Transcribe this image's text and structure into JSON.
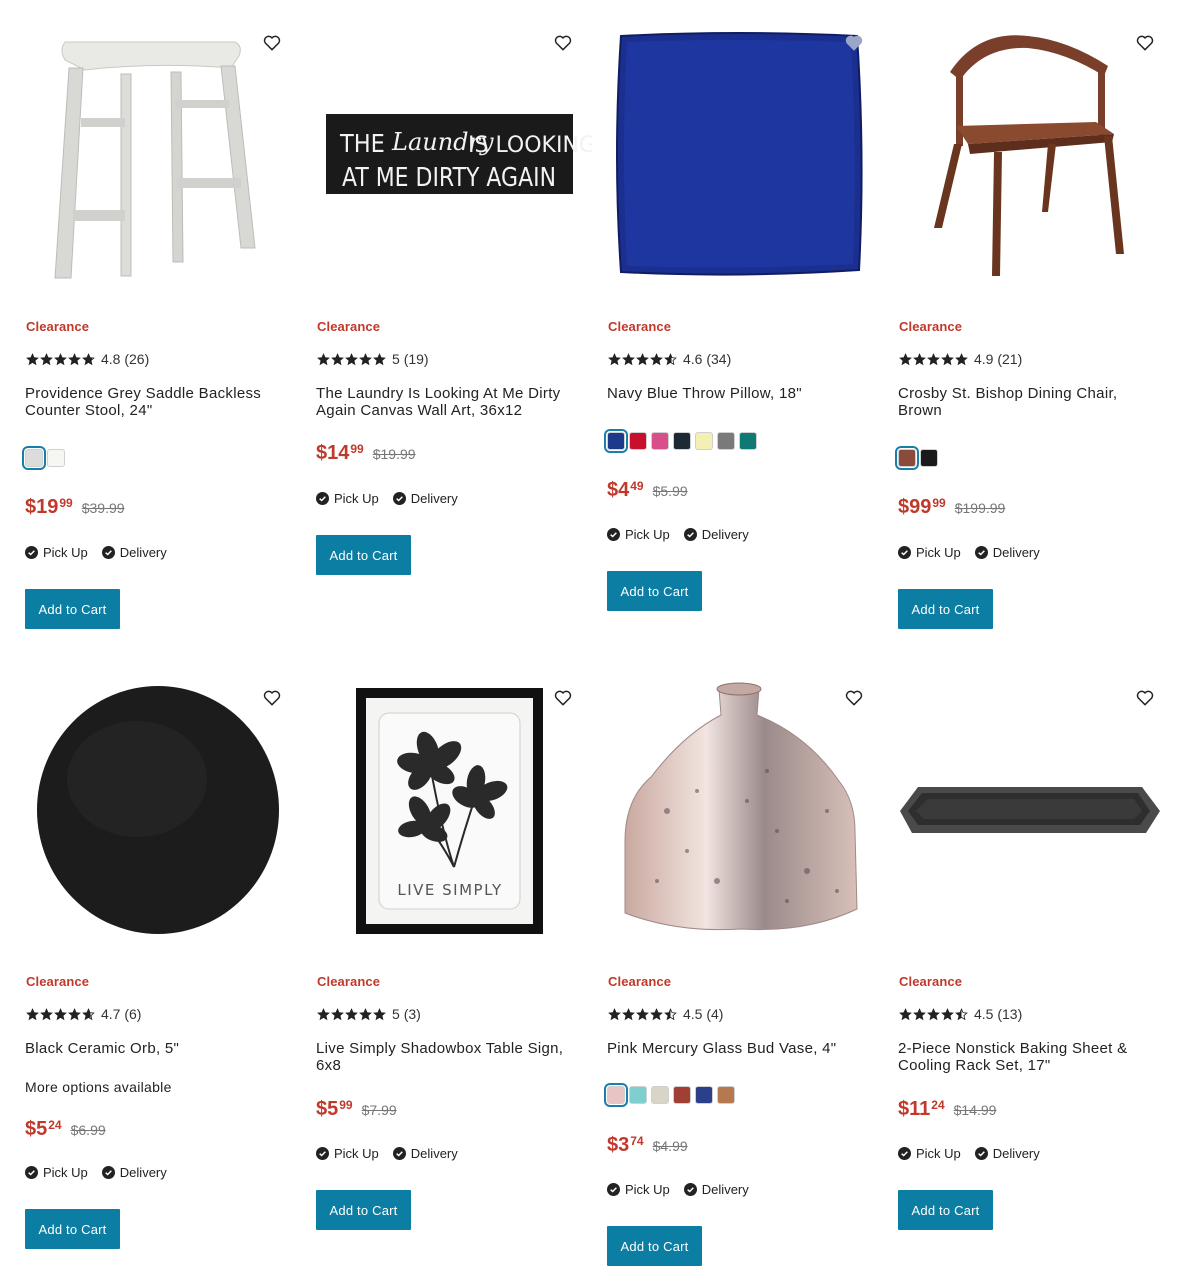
{
  "products": [
    {
      "badge": "Clearance",
      "rating": "4.8",
      "reviews": "(26)",
      "stars": 4.8,
      "title": "Providence Grey Saddle Backless Counter Stool, 24\"",
      "swatches": [
        "#dcdcdc",
        "#f6f6f2"
      ],
      "price_dollars": "$19",
      "price_cents": "99",
      "was_price": "$39.99",
      "pickup": "Pick Up",
      "delivery": "Delivery",
      "cart_label": "Add to Cart",
      "image": "stool-image"
    },
    {
      "badge": "Clearance",
      "rating": "5",
      "reviews": "(19)",
      "stars": 5,
      "title": "The Laundry Is Looking At Me Dirty Again Canvas Wall Art, 36x12",
      "image_text_line1": "THE",
      "image_text_script": "Laundry",
      "image_text_line1b": "IS LOOKING",
      "image_text_line2": "AT ME DIRTY AGAIN",
      "price_dollars": "$14",
      "price_cents": "99",
      "was_price": "$19.99",
      "pickup": "Pick Up",
      "delivery": "Delivery",
      "cart_label": "Add to Cart",
      "image": "canvas-art-image"
    },
    {
      "badge": "Clearance",
      "rating": "4.6",
      "reviews": "(34)",
      "stars": 4.6,
      "title": "Navy Blue Throw Pillow, 18\"",
      "swatches": [
        "#1b3a8c",
        "#c8102e",
        "#d94f8a",
        "#1c2a35",
        "#f4efb3",
        "#7a7a7a",
        "#0f7a74"
      ],
      "price_dollars": "$4",
      "price_cents": "49",
      "was_price": "$5.99",
      "pickup": "Pick Up",
      "delivery": "Delivery",
      "cart_label": "Add to Cart",
      "image": "pillow-image"
    },
    {
      "badge": "Clearance",
      "rating": "4.9",
      "reviews": "(21)",
      "stars": 4.9,
      "title": "Crosby St. Bishop Dining Chair, Brown",
      "swatches": [
        "#8a4b3a",
        "#1a1a1a"
      ],
      "price_dollars": "$99",
      "price_cents": "99",
      "was_price": "$199.99",
      "pickup": "Pick Up",
      "delivery": "Delivery",
      "cart_label": "Add to Cart",
      "image": "chair-image"
    },
    {
      "badge": "Clearance",
      "rating": "4.7",
      "reviews": "(6)",
      "stars": 4.7,
      "title": "Black Ceramic Orb, 5\"",
      "more_options": "More options available",
      "price_dollars": "$5",
      "price_cents": "24",
      "was_price": "$6.99",
      "pickup": "Pick Up",
      "delivery": "Delivery",
      "cart_label": "Add to Cart",
      "image": "orb-image"
    },
    {
      "badge": "Clearance",
      "rating": "5",
      "reviews": "(3)",
      "stars": 5,
      "title": "Live Simply Shadowbox Table Sign, 6x8",
      "image_text": "LIVE SIMPLY",
      "price_dollars": "$5",
      "price_cents": "99",
      "was_price": "$7.99",
      "pickup": "Pick Up",
      "delivery": "Delivery",
      "cart_label": "Add to Cart",
      "image": "shadowbox-image"
    },
    {
      "badge": "Clearance",
      "rating": "4.5",
      "reviews": "(4)",
      "stars": 4.5,
      "title": "Pink Mercury Glass Bud Vase, 4\"",
      "swatches": [
        "#e8c4c4",
        "#7fcfd0",
        "#d9d4c8",
        "#a04035",
        "#2c3f8a",
        "#b5784f"
      ],
      "price_dollars": "$3",
      "price_cents": "74",
      "was_price": "$4.99",
      "pickup": "Pick Up",
      "delivery": "Delivery",
      "cart_label": "Add to Cart",
      "image": "vase-image"
    },
    {
      "badge": "Clearance",
      "rating": "4.5",
      "reviews": "(13)",
      "stars": 4.5,
      "title": "2-Piece Nonstick Baking Sheet & Cooling Rack Set, 17\"",
      "price_dollars": "$11",
      "price_cents": "24",
      "was_price": "$14.99",
      "pickup": "Pick Up",
      "delivery": "Delivery",
      "cart_label": "Add to Cart",
      "image": "baking-sheet-image"
    }
  ],
  "colors": {
    "accent": "#0d7ea3",
    "clearance": "#c0392b",
    "price": "#c0392b"
  }
}
